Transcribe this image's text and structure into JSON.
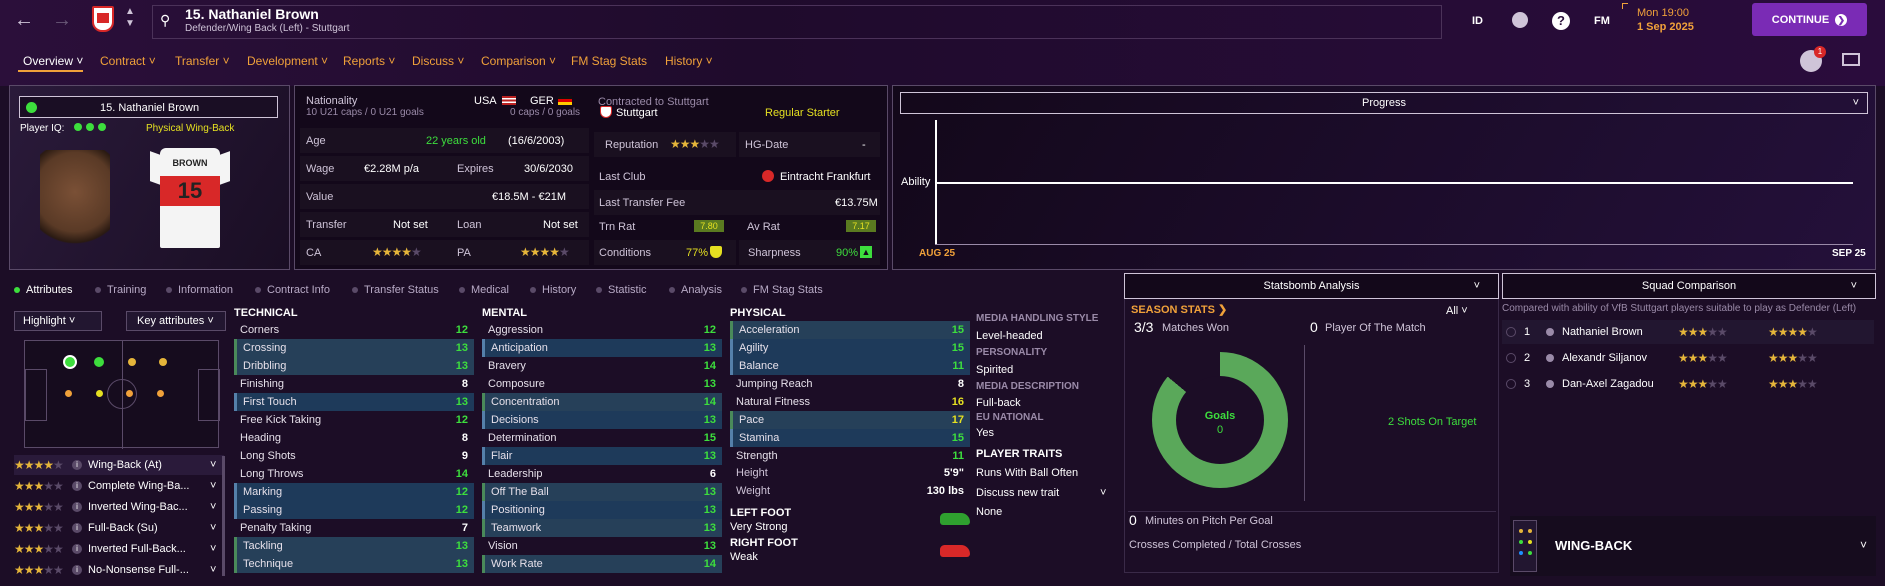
{
  "header": {
    "player_name": "15. Nathaniel Brown",
    "player_sub": "Defender/Wing Back (Left) - Stuttgart",
    "id_label": "ID",
    "fm_label": "FM",
    "time": "Mon 19:00",
    "date": "1 Sep 2025",
    "continue_label": "CONTINUE",
    "notif_count": "1"
  },
  "menu": [
    "Overview",
    "Contract",
    "Transfer",
    "Development",
    "Reports",
    "Discuss",
    "Comparison",
    "FM Stag Stats",
    "History"
  ],
  "profile": {
    "name": "15. Nathaniel Brown",
    "iq_label": "Player IQ:",
    "role_label": "Physical Wing-Back",
    "shirt_name": "BROWN",
    "shirt_num": "15"
  },
  "info": {
    "nationality_label": "Nationality",
    "nat1": "USA",
    "nat2": "GER",
    "caps1": "10 U21 caps / 0 U21 goals",
    "caps2": "0 caps / 0 goals",
    "age_label": "Age",
    "age_val": "22 years old",
    "dob": "(16/6/2003)",
    "wage_label": "Wage",
    "wage_val": "€2.28M p/a",
    "expires_label": "Expires",
    "expires_val": "30/6/2030",
    "value_label": "Value",
    "value_val": "€18.5M - €21M",
    "transfer_label": "Transfer",
    "transfer_val": "Not set",
    "loan_label": "Loan",
    "loan_val": "Not set",
    "ca_label": "CA",
    "pa_label": "PA"
  },
  "contract": {
    "contracted_label": "Contracted to Stuttgart",
    "club": "Stuttgart",
    "status": "Regular Starter",
    "reputation_label": "Reputation",
    "hg_label": "HG-Date",
    "hg_val": "-",
    "last_club_label": "Last Club",
    "last_club": "Eintracht Frankfurt",
    "fee_label": "Last Transfer Fee",
    "fee_val": "€13.75M",
    "trn_label": "Trn Rat",
    "trn_val": "7.80",
    "av_label": "Av Rat",
    "av_val": "7.17",
    "cond_label": "Conditions",
    "cond_val": "77%",
    "sharp_label": "Sharpness",
    "sharp_val": "90%"
  },
  "progress": {
    "title": "Progress",
    "y_label": "Ability",
    "x_start": "AUG 25",
    "x_end": "SEP 25"
  },
  "tabs": [
    "Attributes",
    "Training",
    "Information",
    "Contract Info",
    "Transfer Status",
    "Medical",
    "History",
    "Statistic",
    "Analysis",
    "FM Stag Stats"
  ],
  "left_controls": {
    "highlight": "Highlight",
    "key_attr": "Key attributes"
  },
  "roles": [
    {
      "name": "Wing-Back (At)",
      "full": 3.5
    },
    {
      "name": "Complete Wing-Ba...",
      "full": 3
    },
    {
      "name": "Inverted Wing-Bac...",
      "full": 3
    },
    {
      "name": "Full-Back (Su)",
      "full": 3
    },
    {
      "name": "Inverted Full-Back...",
      "full": 3
    },
    {
      "name": "No-Nonsense Full-...",
      "full": 2.5
    }
  ],
  "technical": {
    "title": "TECHNICAL",
    "rows": [
      [
        "Corners",
        "12"
      ],
      [
        "Crossing",
        "13"
      ],
      [
        "Dribbling",
        "13"
      ],
      [
        "Finishing",
        "8"
      ],
      [
        "First Touch",
        "13"
      ],
      [
        "Free Kick Taking",
        "12"
      ],
      [
        "Heading",
        "8"
      ],
      [
        "Long Shots",
        "9"
      ],
      [
        "Long Throws",
        "14"
      ],
      [
        "Marking",
        "12"
      ],
      [
        "Passing",
        "12"
      ],
      [
        "Penalty Taking",
        "7"
      ],
      [
        "Tackling",
        "13"
      ],
      [
        "Technique",
        "13"
      ]
    ]
  },
  "mental": {
    "title": "MENTAL",
    "rows": [
      [
        "Aggression",
        "12"
      ],
      [
        "Anticipation",
        "13"
      ],
      [
        "Bravery",
        "14"
      ],
      [
        "Composure",
        "13"
      ],
      [
        "Concentration",
        "14"
      ],
      [
        "Decisions",
        "13"
      ],
      [
        "Determination",
        "15"
      ],
      [
        "Flair",
        "13"
      ],
      [
        "Leadership",
        "6"
      ],
      [
        "Off The Ball",
        "13"
      ],
      [
        "Positioning",
        "13"
      ],
      [
        "Teamwork",
        "13"
      ],
      [
        "Vision",
        "13"
      ],
      [
        "Work Rate",
        "14"
      ]
    ]
  },
  "physical": {
    "title": "PHYSICAL",
    "rows": [
      [
        "Acceleration",
        "15"
      ],
      [
        "Agility",
        "15"
      ],
      [
        "Balance",
        "11"
      ],
      [
        "Jumping Reach",
        "8"
      ],
      [
        "Natural Fitness",
        "16"
      ],
      [
        "Pace",
        "17"
      ],
      [
        "Stamina",
        "15"
      ],
      [
        "Strength",
        "11"
      ]
    ],
    "height_label": "Height",
    "height_val": "5'9\"",
    "weight_label": "Weight",
    "weight_val": "130 lbs",
    "left_foot_label": "LEFT FOOT",
    "left_foot_val": "Very Strong",
    "right_foot_label": "RIGHT FOOT",
    "right_foot_val": "Weak"
  },
  "media": {
    "mh_title": "MEDIA HANDLING STYLE",
    "mh_val": "Level-headed",
    "pers_title": "PERSONALITY",
    "pers_val": "Spirited",
    "desc_title": "MEDIA DESCRIPTION",
    "desc_val": "Full-back",
    "eu_title": "EU NATIONAL",
    "eu_val": "Yes",
    "traits_title": "PLAYER TRAITS",
    "trait1": "Runs With Ball Often",
    "trait_discuss": "Discuss new trait",
    "trait_none": "None"
  },
  "statsbomb": {
    "title": "Statsbomb Analysis",
    "season": "SEASON STATS",
    "filter": "All",
    "matches_won_num": "3/3",
    "matches_won_label": "Matches Won",
    "potm_num": "0",
    "potm_label": "Player Of The Match",
    "donut_label": "Goals",
    "donut_val": "0",
    "shots": "2 Shots On Target",
    "mins_num": "0",
    "mins_label": "Minutes on Pitch Per Goal",
    "crosses": "Crosses Completed / Total Crosses"
  },
  "squad": {
    "title": "Squad Comparison",
    "sub": "Compared with ability of VfB Stuttgart players suitable to play as Defender (Left)",
    "rows": [
      {
        "rank": "1",
        "name": "Nathaniel Brown"
      },
      {
        "rank": "2",
        "name": "Alexandr Siljanov"
      },
      {
        "rank": "3",
        "name": "Dan-Axel Zagadou"
      }
    ],
    "role_label": "WING-BACK"
  },
  "colors": {
    "accent": "#f0a13a",
    "green": "#3dde3d",
    "yellow": "#e5e021",
    "purple": "#7a2bb5"
  }
}
